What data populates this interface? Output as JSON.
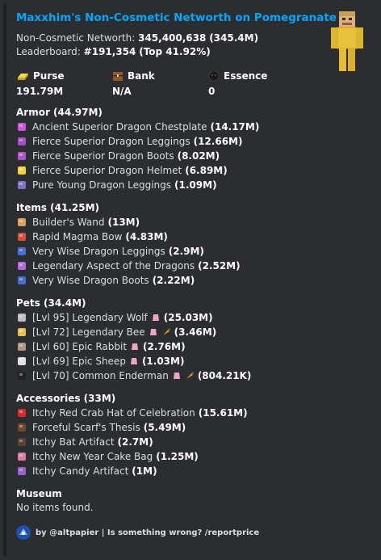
{
  "title": "Maxxhim's Non-Cosmetic Networth on Pomegranate",
  "summary": {
    "networth_label": "Non-Cosmetic Networth:",
    "networth_value": "345,400,638",
    "networth_short": "(345.4M)",
    "leaderboard_label": "Leaderboard:",
    "leaderboard_value": "#191,354",
    "leaderboard_top": "(Top 41.92%)"
  },
  "fields": [
    {
      "icon": "gold-ingot-icon",
      "name": "Purse",
      "value": "191.79M"
    },
    {
      "icon": "chest-icon",
      "name": "Bank",
      "value": "N/A"
    },
    {
      "icon": "wither-essence-icon",
      "name": "Essence",
      "value": "0"
    }
  ],
  "armor": {
    "header": "Armor (44.97M)",
    "items": [
      {
        "name": "Ancient Superior Dragon Chestplate",
        "value": "(14.17M)",
        "icon": "chestplate-icon",
        "color": "#c957d9"
      },
      {
        "name": "Fierce Superior Dragon Leggings",
        "value": "(12.66M)",
        "icon": "leggings-icon",
        "color": "#a64fc2"
      },
      {
        "name": "Fierce Superior Dragon Boots",
        "value": "(8.02M)",
        "icon": "boots-icon",
        "color": "#b056c7"
      },
      {
        "name": "Fierce Superior Dragon Helmet",
        "value": "(6.89M)",
        "icon": "helmet-icon",
        "color": "#f2d13a"
      },
      {
        "name": "Pure Young Dragon Leggings",
        "value": "(1.09M)",
        "icon": "leggings-icon",
        "color": "#7d73c9"
      }
    ]
  },
  "items": {
    "header": "Items (41.25M)",
    "items": [
      {
        "name": "Builder's Wand",
        "value": "(13M)",
        "icon": "wand-icon",
        "color": "#d9a05b"
      },
      {
        "name": "Rapid Magma Bow",
        "value": "(4.83M)",
        "icon": "bow-icon",
        "color": "#d94f3b"
      },
      {
        "name": "Very Wise Dragon Leggings",
        "value": "(2.9M)",
        "icon": "leggings-icon",
        "color": "#4a6bd1"
      },
      {
        "name": "Legendary Aspect of the Dragons",
        "value": "(2.52M)",
        "icon": "sword-icon",
        "color": "#b36bd9"
      },
      {
        "name": "Very Wise Dragon Boots",
        "value": "(2.22M)",
        "icon": "boots-icon",
        "color": "#4a6bd1"
      }
    ]
  },
  "pets": {
    "header": "Pets (34.4M)",
    "items": [
      {
        "name": "[Lvl 95] Legendary Wolf",
        "value": "(25.03M)",
        "icon": "wolf-icon",
        "color": "#bfbfbf",
        "extras": [
          "pet-item-icon"
        ]
      },
      {
        "name": "[Lvl 72] Legendary Bee",
        "value": "(3.46M)",
        "icon": "bee-icon",
        "color": "#e6c24a",
        "extras": [
          "pet-item-icon",
          "carrot-icon"
        ]
      },
      {
        "name": "[Lvl 60] Epic Rabbit",
        "value": "(2.76M)",
        "icon": "rabbit-icon",
        "color": "#a89a86",
        "extras": [
          "pet-item-icon"
        ]
      },
      {
        "name": "[Lvl 69] Epic Sheep",
        "value": "(1.03M)",
        "icon": "sheep-icon",
        "color": "#e0e0e0",
        "extras": [
          "pet-item-icon"
        ]
      },
      {
        "name": "[Lvl 70] Common Enderman",
        "value": "(804.21K)",
        "icon": "enderman-icon",
        "color": "#222222",
        "extras": [
          "pet-item-icon",
          "carrot-icon"
        ]
      }
    ]
  },
  "accessories": {
    "header": "Accessories (33M)",
    "items": [
      {
        "name": "Itchy Red Crab Hat of Celebration",
        "value": "(15.61M)",
        "icon": "crab-hat-icon",
        "color": "#d92b2b"
      },
      {
        "name": "Forceful Scarf's Thesis",
        "value": "(5.49M)",
        "icon": "book-icon",
        "color": "#6b4a2e"
      },
      {
        "name": "Itchy Bat Artifact",
        "value": "(2.7M)",
        "icon": "bat-icon",
        "color": "#5a4030"
      },
      {
        "name": "Itchy New Year Cake Bag",
        "value": "(1.25M)",
        "icon": "cake-bag-icon",
        "color": "#e07aa6"
      },
      {
        "name": "Itchy Candy Artifact",
        "value": "(1M)",
        "icon": "candy-icon",
        "color": "#9a5fd1"
      }
    ]
  },
  "museum": {
    "header": "Museum",
    "text": "No items found."
  },
  "footer": {
    "text": "by @altpapier | Is something wrong? /reportprice"
  }
}
